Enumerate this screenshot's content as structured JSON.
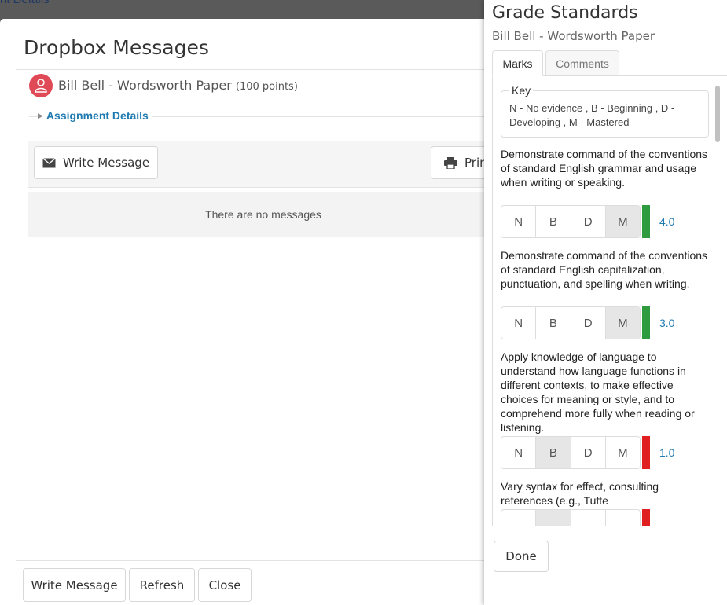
{
  "background": {
    "link_text": "nt Details"
  },
  "modal": {
    "title": "Dropbox Messages",
    "student_name": "Bill Bell - Wordsworth Paper",
    "points": "(100 points)",
    "details_label": "Assignment Details",
    "write_message_label": "Write Message",
    "print_label": "Prin",
    "empty_text": "There are no messages",
    "footer": {
      "write_message": "Write Message",
      "refresh": "Refresh",
      "close": "Close"
    }
  },
  "panel": {
    "title": "Grade Standards",
    "subtitle": "Bill Bell - Wordsworth Paper",
    "tabs": [
      {
        "label": "Marks"
      },
      {
        "label": "Comments"
      }
    ],
    "key_legend": "Key",
    "key_text": "N - No evidence , B - Beginning , D - Developing , M - Mastered",
    "mark_labels": [
      "N",
      "B",
      "D",
      "M"
    ],
    "standards": [
      {
        "text": "Demonstrate command of the conventions of standard English grammar and usage when writing or speaking.",
        "selected": "M",
        "score": "4.0",
        "color": "#2e9b3e"
      },
      {
        "text": "Demonstrate command of the conventions of standard English capitalization, punctuation, and spelling when writing.",
        "selected": "M",
        "score": "3.0",
        "color": "#2e9b3e"
      },
      {
        "text": "Apply knowledge of language to understand how language functions in different contexts, to make effective choices for meaning or style, and to comprehend more fully when reading or listening.",
        "selected": "B",
        "score": "1.0",
        "color": "#e02020"
      },
      {
        "text": "Vary syntax for effect, consulting references (e.g., Tufte",
        "selected": "B",
        "score": "",
        "color": "#e02020"
      }
    ],
    "done_label": "Done"
  }
}
